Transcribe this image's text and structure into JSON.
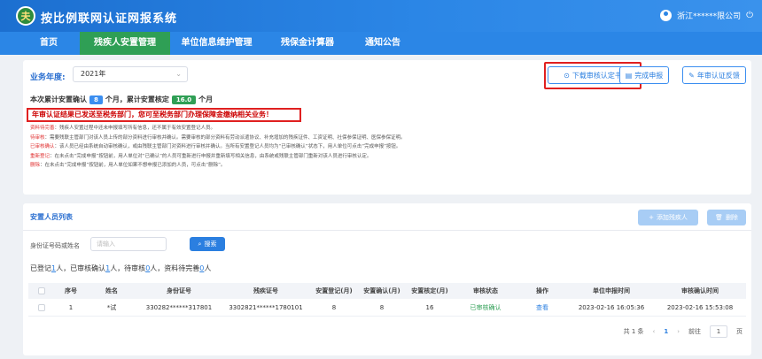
{
  "header": {
    "logo_text": "夫",
    "title": "按比例联网认证网报系统",
    "company": "浙江******限公司",
    "logout_glyph": "⏻"
  },
  "nav": {
    "items": [
      {
        "label": "首页"
      },
      {
        "label": "残疾人安置管理"
      },
      {
        "label": "单位信息维护管理"
      },
      {
        "label": "残保金计算器"
      },
      {
        "label": "通知公告"
      }
    ],
    "active_index": 1
  },
  "toolbar": {
    "year_label": "业务年度:",
    "year_value": "2021年",
    "download_label": "下载审核认定书",
    "complete_label": "完成申报",
    "feedback_label": "年审认证反馈"
  },
  "stats": {
    "prefix": "本次累计安置确认",
    "confirm_count": "8",
    "mid": "个月，累计安置核定",
    "verify_count": "16.0",
    "suffix": "个月"
  },
  "notice": "年审认证结果已发送至税务部门，您可至税务部门办理保障金缴纳相关业务！",
  "notes": [
    {
      "key": "资料待完善",
      "text": "：残疾人安置过程中还未申报填写所有信息，还不属于有效安置登记人员。"
    },
    {
      "key": "待审核",
      "text": "：需要残联主管部门对该人员上传的部分资料进行审核并确认。需要审核的部分资料有劳动派遣协议、补充增加的残疾证件、工资证明、社保参保证明、医保参保证明。"
    },
    {
      "key": "已审核确认",
      "text": "：该人员已经由系统自动审核确认，或由残联主管部门对资料进行审核并确认。当所有安置登记人员均为“已审核确认”状态下，用人单位可点击“完成申报”按钮。"
    },
    {
      "key": "重新登记",
      "text": "：在未点击“完成申报”按钮前，用人单位对“已确认”的人员可重新进行申报并重新填写相关信息，由系统或残联主管部门重新对该人员进行审核认定。"
    },
    {
      "key": "删除",
      "text": "：在未点击“完成申报”按钮前，用人单位如果不想申报已添加的人员，可点击“删除”。"
    }
  ],
  "list": {
    "title": "安置人员列表",
    "add_label": "添加残疾人",
    "delete_label": "删除",
    "search_label": "身份证号码或姓名",
    "search_placeholder": "请输入",
    "search_button": "搜索"
  },
  "summary": {
    "registered_prefix": "已登记",
    "registered": "1",
    "confirmed_prefix": "人，已审核确认",
    "confirmed": "1",
    "pending_prefix": "人，待审核",
    "pending": "0",
    "incomplete_prefix": "人，资料待完善",
    "incomplete": "0",
    "unit": "人"
  },
  "table": {
    "headers": [
      "",
      "序号",
      "姓名",
      "身份证号",
      "残疾证号",
      "安置登记(月)",
      "安置确认(月)",
      "安置核定(月)",
      "审核状态",
      "操作",
      "单位申报时间",
      "审核确认时间"
    ],
    "rows": [
      {
        "index": "1",
        "name": "*试",
        "id_no": "330282******317801",
        "disability_no": "3302821******1780101",
        "registered_months": "8",
        "confirmed_months": "8",
        "verified_months": "16",
        "status": "已审核确认",
        "action": "查看",
        "apply_time": "2023-02-16 16:05:36",
        "confirm_time": "2023-02-16 15:53:08"
      }
    ]
  },
  "pager": {
    "total": "共 1 条",
    "prev": "‹",
    "current": "1",
    "next": "›",
    "goto_label": "前往",
    "goto_value": "1",
    "page_unit": "页"
  }
}
